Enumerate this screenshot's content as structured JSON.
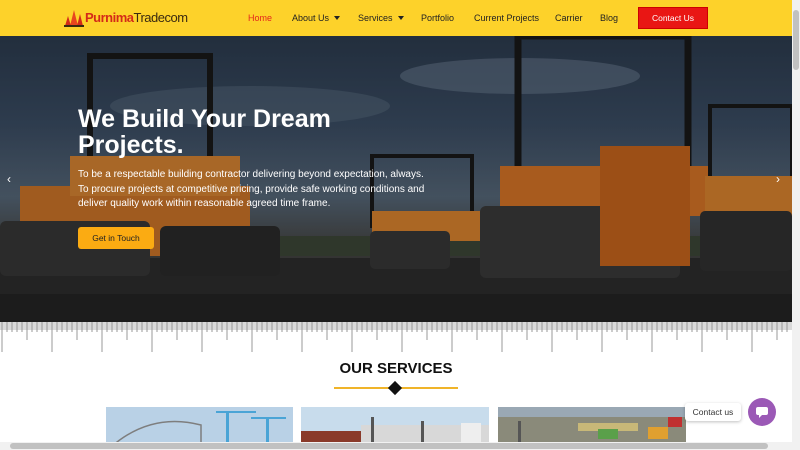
{
  "header": {
    "logo_part1": "Purnima",
    "logo_part2": "Tradecom",
    "nav": [
      {
        "label": "Home"
      },
      {
        "label": "About Us"
      },
      {
        "label": "Services"
      },
      {
        "label": "Portfolio"
      },
      {
        "label": "Current Projects"
      },
      {
        "label": "Carrier"
      },
      {
        "label": "Blog"
      }
    ],
    "contact_label": "Contact Us"
  },
  "hero": {
    "title": "We Build Your Dream Projects.",
    "text": "To be a respectable building contractor delivering beyond expectation, always. To procure projects at competitive pricing, provide safe working conditions and deliver quality work within reasonable agreed time frame.",
    "button_label": "Get in Touch",
    "prev_arrow": "‹",
    "next_arrow": "›"
  },
  "services": {
    "title": "OUR SERVICES"
  },
  "floating": {
    "contact_label": "Contact us"
  },
  "colors": {
    "header_bg": "#fdd22a",
    "accent_red": "#e91614",
    "button_orange": "#fbab12",
    "chat_purple": "#9b59b6"
  }
}
